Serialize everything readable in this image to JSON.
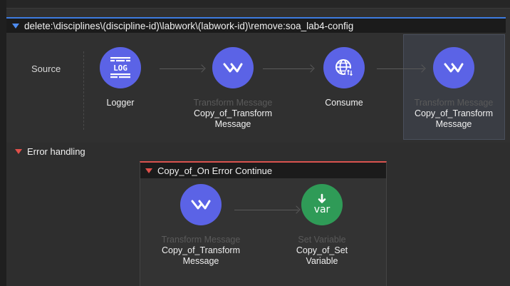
{
  "flow": {
    "title": "delete:\\disciplines\\(discipline-id)\\labwork\\(labwork-id)\\remove:soa_lab4-config",
    "source_label": "Source",
    "nodes": [
      {
        "type": "",
        "name_line1": "Logger",
        "name_line2": "",
        "icon": "log-icon"
      },
      {
        "type": "Transform Message",
        "name_line1": "Copy_of_Transform",
        "name_line2": "Message",
        "icon": "transform-icon"
      },
      {
        "type": "",
        "name_line1": "Consume",
        "name_line2": "",
        "icon": "globe-icon"
      },
      {
        "type": "Transform Message",
        "name_line1": "Copy_of_Transform",
        "name_line2": "Message",
        "icon": "transform-icon"
      }
    ]
  },
  "error_handling": {
    "title": "Error handling",
    "handler": {
      "title": "Copy_of_On Error Continue",
      "nodes": [
        {
          "type": "Transform Message",
          "name_line1": "Copy_of_Transform",
          "name_line2": "Message",
          "icon": "transform-icon"
        },
        {
          "type": "Set Variable",
          "name_line1": "Copy_of_Set",
          "name_line2": "Variable",
          "icon": "var-icon",
          "icon_text": "var"
        }
      ]
    }
  },
  "colors": {
    "accent_blue": "#3d7be0",
    "node_blue": "#5b63e6",
    "node_green": "#2f9b57",
    "error_red": "#d9534f"
  }
}
